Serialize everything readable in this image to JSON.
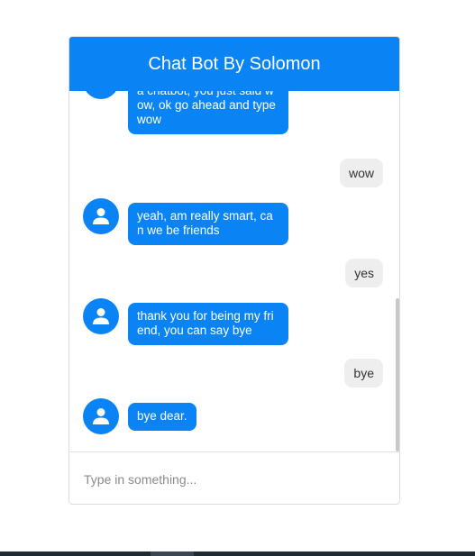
{
  "header": {
    "title": "Chat Bot By Solomon"
  },
  "messages": [
    {
      "sender": "bot",
      "text": "my name is solomon, am a chatbot, you just said wow, ok go ahead and type wow"
    },
    {
      "sender": "user",
      "text": "wow"
    },
    {
      "sender": "bot",
      "text": "yeah, am really smart, can we be friends"
    },
    {
      "sender": "user",
      "text": "yes"
    },
    {
      "sender": "bot",
      "text": "thank you for being my friend, you can say bye"
    },
    {
      "sender": "user",
      "text": "bye"
    },
    {
      "sender": "bot",
      "text": "bye dear."
    }
  ],
  "input": {
    "placeholder": "Type in something...",
    "value": ""
  },
  "icons": {
    "avatar": "user-icon"
  },
  "colors": {
    "accent": "#0a84f5",
    "user_bubble": "#eeeeee"
  }
}
